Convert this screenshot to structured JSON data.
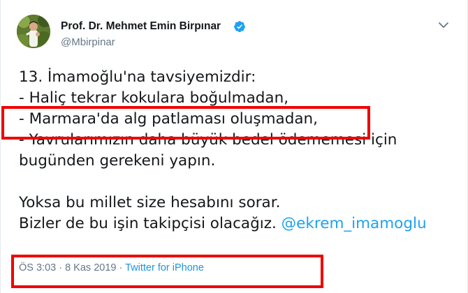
{
  "tweet": {
    "author": {
      "display_name": "Prof. Dr. Mehmet Emin Birpınar",
      "handle": "@Mbirpinar",
      "verified_icon": "verified-badge-icon",
      "avatar_icon": "avatar-photo"
    },
    "menu_icon": "chevron-down-icon",
    "body": {
      "lines": [
        "13. İmamoğlu'na tavsiyemizdir:",
        " - Haliç tekrar kokulara boğulmadan,",
        " - Marmara'da alg patlaması oluşmadan,",
        " - Yavrularımızın daha büyük bedel ödememesi için",
        "bugünden gerekeni yapın.",
        "",
        "Yoksa bu millet size hesabını sorar.",
        "Bizler de bu işin takipçisi olacağız. "
      ],
      "mention": "@ekrem_imamoglu"
    },
    "meta": {
      "time": "ÖS 3:03",
      "separator_1": " · ",
      "date": "8 Kas 2019",
      "separator_2": " · ",
      "source": "Twitter for iPhone"
    }
  },
  "colors": {
    "text": "#14171a",
    "secondary": "#657786",
    "link": "#1da1f2",
    "verified": "#1da1f2",
    "highlight_box": "#f00000"
  }
}
